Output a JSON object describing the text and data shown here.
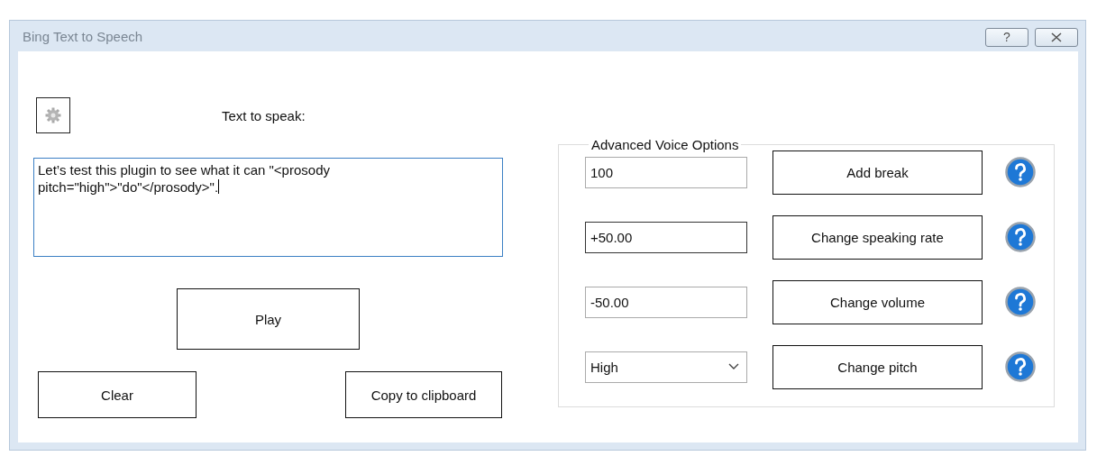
{
  "window": {
    "title": "Bing Text to Speech",
    "help_button": "?"
  },
  "text_label": "Text to speak:",
  "text_input": {
    "value": "Let’s test this plugin to see what it can \"<prosody pitch=\"high\">\"do\"</prosody>\".",
    "focused": true
  },
  "buttons": {
    "play": "Play",
    "clear": "Clear",
    "copy": "Copy to clipboard"
  },
  "advanced": {
    "title": "Advanced Voice Options",
    "rows": [
      {
        "kind": "text",
        "value": "100",
        "button": "Add break",
        "active": false
      },
      {
        "kind": "text",
        "value": "+50.00",
        "button": "Change speaking rate",
        "active": true
      },
      {
        "kind": "text",
        "value": "-50.00",
        "button": "Change volume",
        "active": false
      },
      {
        "kind": "dropdown",
        "value": "High",
        "button": "Change pitch",
        "active": false
      }
    ]
  }
}
